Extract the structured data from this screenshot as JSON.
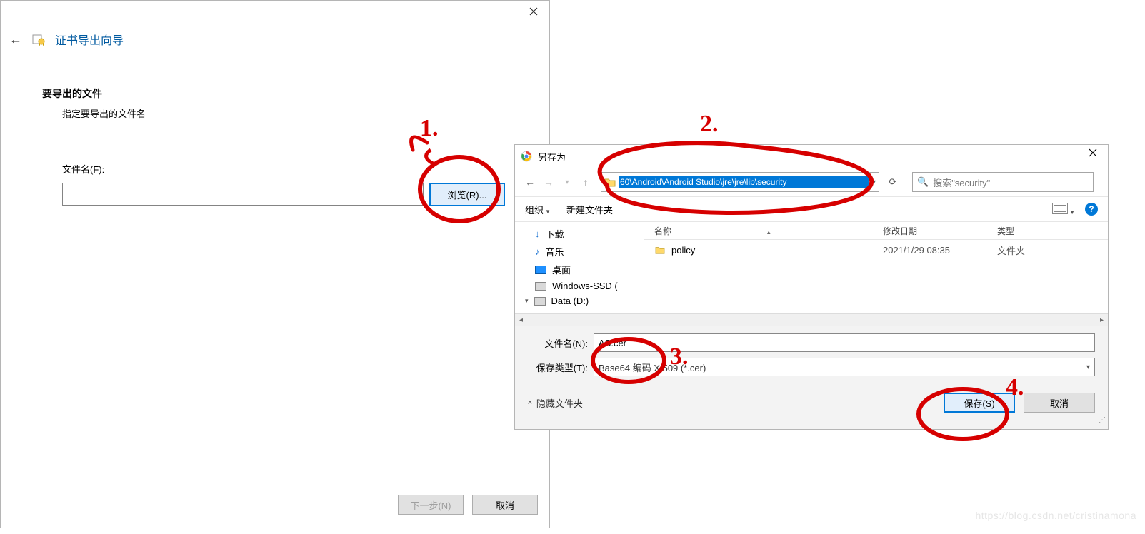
{
  "wizard": {
    "title": "证书导出向导",
    "section_heading": "要导出的文件",
    "section_sub": "指定要导出的文件名",
    "filename_label": "文件名(F):",
    "filename_value": "",
    "browse_label": "浏览(R)...",
    "next_label": "下一步(N)",
    "cancel_label": "取消"
  },
  "save_as": {
    "title": "另存为",
    "address_path": "60\\Android\\Android Studio\\jre\\jre\\lib\\security",
    "search_placeholder": "搜索\"security\"",
    "toolbar": {
      "organize": "组织",
      "new_folder": "新建文件夹"
    },
    "nav_items": [
      {
        "label": "下载",
        "icon": "download-icon"
      },
      {
        "label": "音乐",
        "icon": "music-icon"
      },
      {
        "label": "桌面",
        "icon": "desktop-icon"
      },
      {
        "label": "Windows-SSD (",
        "icon": "disk-icon"
      },
      {
        "label": "Data (D:)",
        "icon": "disk-icon"
      }
    ],
    "columns": {
      "name": "名称",
      "date": "修改日期",
      "type": "类型"
    },
    "rows": [
      {
        "name": "policy",
        "date": "2021/1/29 08:35",
        "type": "文件夹"
      }
    ],
    "filename_label": "文件名(N):",
    "filename_value": "AS.cer",
    "filetype_label": "保存类型(T):",
    "filetype_value": "Base64 编码 X.509 (*.cer)",
    "hide_folders": "隐藏文件夹",
    "save_label": "保存(S)",
    "cancel_label": "取消"
  },
  "annotations": {
    "a1": "1.",
    "a2": "2.",
    "a3": "3.",
    "a4": "4."
  },
  "watermark": "https://blog.csdn.net/cristinamona"
}
